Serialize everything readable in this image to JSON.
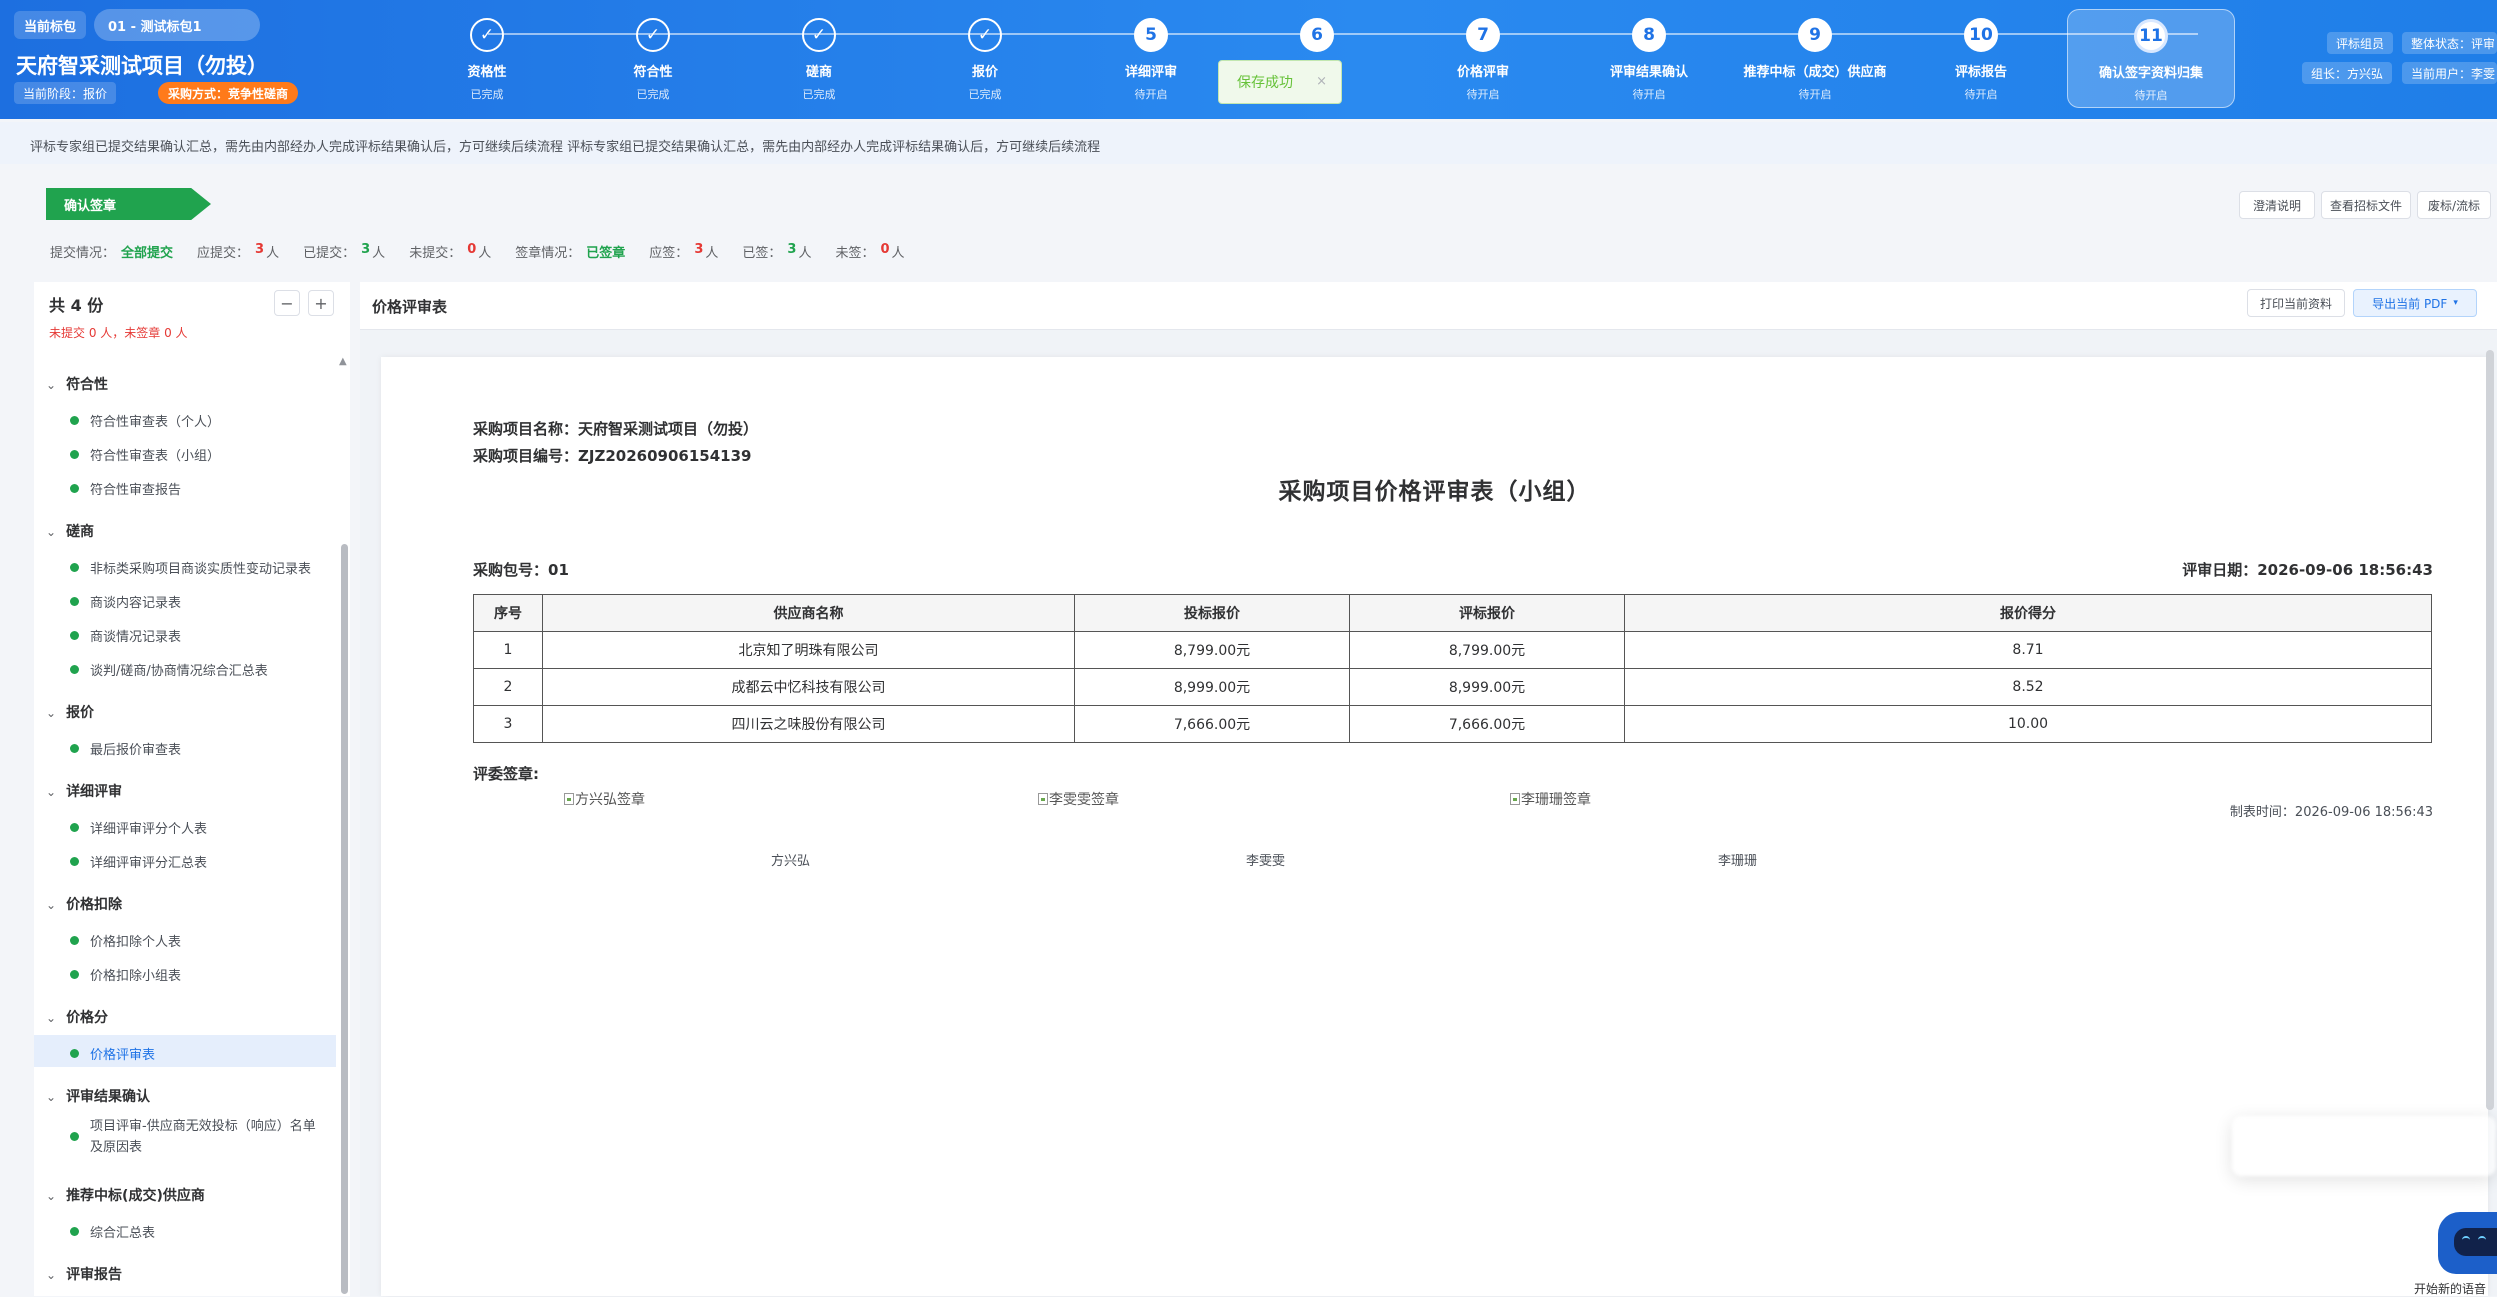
{
  "header": {
    "package_tag": "当前标包",
    "package_select": "01 - 测试标包1",
    "project_title": "天府智采测试项目（勿投）",
    "current_stage": "当前阶段：报价",
    "method": "采购方式：竞争性磋商",
    "steps": [
      {
        "num": "✓",
        "name": "资格性",
        "status": "已完成",
        "done": true
      },
      {
        "num": "✓",
        "name": "符合性",
        "status": "已完成",
        "done": true
      },
      {
        "num": "✓",
        "name": "磋商",
        "status": "已完成",
        "done": true
      },
      {
        "num": "✓",
        "name": "报价",
        "status": "已完成",
        "done": true
      },
      {
        "num": "5",
        "name": "详细评审",
        "status": "待开启",
        "done": false
      },
      {
        "num": "6",
        "name": "",
        "status": "",
        "done": false
      },
      {
        "num": "7",
        "name": "价格评审",
        "status": "待开启",
        "done": false
      },
      {
        "num": "8",
        "name": "评审结果确认",
        "status": "待开启",
        "done": false
      },
      {
        "num": "9",
        "name": "推荐中标（成交）供应商",
        "status": "待开启",
        "done": false
      },
      {
        "num": "10",
        "name": "评标报告",
        "status": "待开启",
        "done": false
      },
      {
        "num": "11",
        "name": "确认签字资料归集",
        "status": "待开启",
        "done": false
      }
    ],
    "toast": "保存成功",
    "toast_close": "×",
    "role": "评标组员",
    "overall_status": "整体状态：评审",
    "leader": "组长：方兴弘",
    "current_user": "当前用户：李雯"
  },
  "notice": "评标专家组已提交结果确认汇总，需先由内部经办人完成评标结果确认后，方可继续后续流程 评标专家组已提交结果确认汇总，需先由内部经办人完成评标结果确认后，方可继续后续流程",
  "toolbar": {
    "sign_tag": "确认签章",
    "btn_clarify": "澄清说明",
    "btn_view_file": "查看招标文件",
    "btn_void": "废标/流标"
  },
  "stats": {
    "submit_label": "提交情况：",
    "submit_value": "全部提交",
    "should_submit_label": "应提交：",
    "should_submit": "3",
    "submitted_label": "已提交：",
    "submitted": "3",
    "not_submitted_label": "未提交：",
    "not_submitted": "0",
    "sign_label": "签章情况：",
    "sign_value": "已签章",
    "should_sign_label": "应签：",
    "should_sign": "3",
    "signed_label": "已签：",
    "signed": "3",
    "unsigned_label": "未签：",
    "unsigned": "0",
    "unit": "人"
  },
  "sidebar": {
    "count": "共 4 份",
    "warn": "未提交 0 人，未签章 0 人",
    "collapse": "−",
    "expand": "+",
    "groups": [
      {
        "label": "符合性",
        "items": [
          "符合性审查表（个人）",
          "符合性审查表（小组）",
          "符合性审查报告"
        ]
      },
      {
        "label": "磋商",
        "items": [
          "非标类采购项目商谈实质性变动记录表",
          "商谈内容记录表",
          "商谈情况记录表",
          "谈判/磋商/协商情况综合汇总表"
        ]
      },
      {
        "label": "报价",
        "items": [
          "最后报价审查表"
        ]
      },
      {
        "label": "详细评审",
        "items": [
          "详细评审评分个人表",
          "详细评审评分汇总表"
        ]
      },
      {
        "label": "价格扣除",
        "items": [
          "价格扣除个人表",
          "价格扣除小组表"
        ]
      },
      {
        "label": "价格分",
        "items": [
          "价格评审表"
        ]
      },
      {
        "label": "评审结果确认",
        "items": [
          "项目评审-供应商无效投标（响应）名单及原因表"
        ]
      },
      {
        "label": "推荐中标(成交)供应商",
        "items": [
          "综合汇总表"
        ]
      },
      {
        "label": "评审报告",
        "items": []
      }
    ]
  },
  "content": {
    "title": "价格评审表",
    "btn_print": "打印当前资料",
    "btn_export": "导出当前 PDF",
    "doc": {
      "project_name": "采购项目名称：天府智采测试项目（勿投）",
      "project_code": "采购项目编号：ZJZ20260906154139",
      "title": "采购项目价格评审表（小组）",
      "package": "采购包号：01",
      "review_date": "评审日期：2026-09-06 18:56:43",
      "columns": [
        "序号",
        "供应商名称",
        "投标报价",
        "评标报价",
        "报价得分"
      ],
      "rows": [
        [
          "1",
          "北京知了明珠有限公司",
          "8,799.00元",
          "8,799.00元",
          "8.71"
        ],
        [
          "2",
          "成都云中忆科技有限公司",
          "8,999.00元",
          "8,999.00元",
          "8.52"
        ],
        [
          "3",
          "四川云之味股份有限公司",
          "7,666.00元",
          "7,666.00元",
          "10.00"
        ]
      ],
      "sign_label": "评委签章:",
      "signers": [
        {
          "img_alt": "方兴弘签章",
          "name": "方兴弘"
        },
        {
          "img_alt": "李雯雯签章",
          "name": "李雯雯"
        },
        {
          "img_alt": "李珊珊签章",
          "name": "李珊珊"
        }
      ],
      "made_time": "制表时间：2026-09-06 18:56:43"
    }
  },
  "assistant": {
    "label": "开始新的语音"
  }
}
